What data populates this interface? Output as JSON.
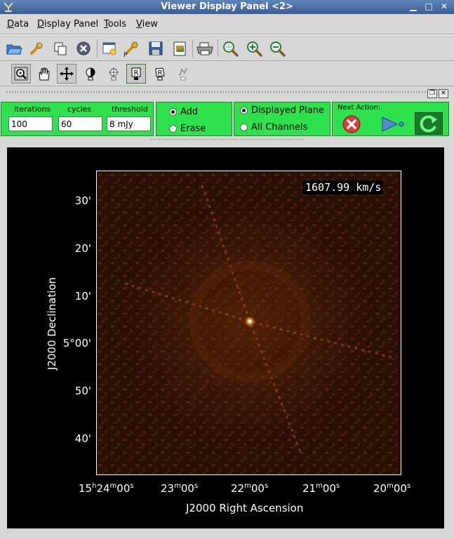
{
  "window": {
    "title": "Viewer Display Panel <2>"
  },
  "menu": {
    "items": [
      {
        "key": "D",
        "rest": "ata"
      },
      {
        "key": "D",
        "rest": "isplay Panel"
      },
      {
        "key": "T",
        "rest": "ools"
      },
      {
        "key": "V",
        "rest": "iew"
      }
    ]
  },
  "toolbar1": {
    "icons": [
      "open-folder-icon",
      "wrench-icon",
      "copy-icon",
      "close-panel-icon",
      "new-panel-icon",
      "panel-wrench-icon",
      "save-icon",
      "export-image-icon",
      "print-icon",
      "zoom-fit-icon",
      "zoom-in-icon",
      "zoom-out-icon"
    ]
  },
  "toolbar2": {
    "icons": [
      "zoom-tool-icon",
      "pan-hand-icon",
      "move-arrows-icon",
      "contrast-tool-icon",
      "crosshair-tool-icon",
      "rectangle-region-icon",
      "polygon-region-icon",
      "polyline-tool-icon"
    ]
  },
  "clean": {
    "iterations_label": "iterations",
    "iterations_value": "100",
    "cycles_label": "cycles",
    "cycles_value": "60",
    "threshold_label": "threshold",
    "threshold_value": "8 mJy",
    "mode": {
      "add": "Add",
      "erase": "Erase",
      "selected": "add"
    },
    "scope": {
      "displayed": "Displayed Plane",
      "all": "All Channels",
      "selected": "displayed"
    },
    "next_action_label": "Next Action:"
  },
  "image": {
    "velocity": "1607.99 km/s",
    "y_axis_title": "J2000 Declination",
    "x_axis_title": "J2000 Right Ascension",
    "y_ticks": [
      "30'",
      "20'",
      "10'",
      "5°00'",
      "50'",
      "40'"
    ],
    "x_ticks": [
      {
        "h": "15",
        "m": "24",
        "s": "00"
      },
      {
        "h": "",
        "m": "23",
        "s": "00"
      },
      {
        "h": "",
        "m": "22",
        "s": "00"
      },
      {
        "h": "",
        "m": "21",
        "s": "00"
      },
      {
        "h": "",
        "m": "20",
        "s": "00"
      }
    ]
  }
}
